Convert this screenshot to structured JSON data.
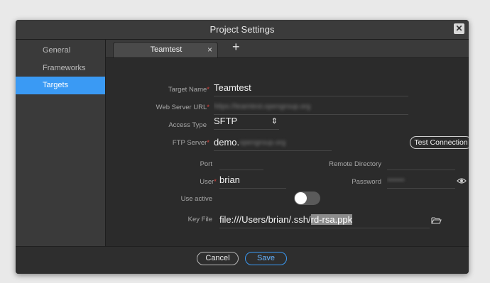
{
  "window": {
    "title": "Project Settings",
    "close_symbol": "✕"
  },
  "sidebar": {
    "items": [
      {
        "label": "General",
        "active": false
      },
      {
        "label": "Frameworks",
        "active": false
      },
      {
        "label": "Targets",
        "active": true
      }
    ]
  },
  "tabs": {
    "items": [
      {
        "label": "Teamtest",
        "close_symbol": "×"
      }
    ],
    "add_symbol": "+"
  },
  "form": {
    "required_marker": "*",
    "target_name": {
      "label": "Target Name",
      "value": "Teamtest"
    },
    "web_server_url": {
      "label": "Web Server URL",
      "value_obscured": "https://teamtest.opengroup.org"
    },
    "access_type": {
      "label": "Access Type",
      "value": "SFTP",
      "symbol": "⇕"
    },
    "ftp_server": {
      "label": "FTP Server",
      "value": "demo.",
      "value_obscured": "opengroup.org",
      "test_button": "Test Connection"
    },
    "port": {
      "label": "Port",
      "value": ""
    },
    "remote_directory": {
      "label": "Remote Directory",
      "value": ""
    },
    "user": {
      "label": "User",
      "value": "brian"
    },
    "password": {
      "label": "Password",
      "value_obscured": "•••••••"
    },
    "use_active": {
      "label": "Use active",
      "enabled": false
    },
    "key_file": {
      "label": "Key File",
      "value_prefix": "file:///Users/brian/.ssh/",
      "value_selected": "rd-rsa.ppk"
    }
  },
  "footer": {
    "cancel_label": "Cancel",
    "save_label": "Save"
  },
  "colors": {
    "accent": "#3a9af4",
    "required": "#e0413a",
    "panel": "#2d2d2d"
  }
}
